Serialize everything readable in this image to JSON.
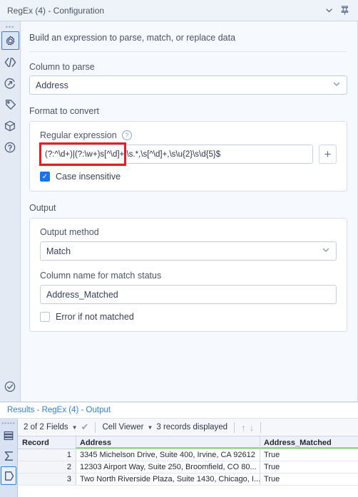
{
  "window": {
    "title": "RegEx (4) - Configuration",
    "collapse_icon": "chevron-down-icon",
    "pin_icon": "pin-icon"
  },
  "rail": {
    "items": [
      {
        "icon": "gear-icon",
        "name": "configuration",
        "selected": true
      },
      {
        "icon": "code-brackets-icon",
        "name": "code",
        "selected": false
      },
      {
        "icon": "annotation-arrow-icon",
        "name": "annotation",
        "selected": false
      },
      {
        "icon": "tag-icon",
        "name": "tag",
        "selected": false
      },
      {
        "icon": "package-cube-icon",
        "name": "package",
        "selected": false
      },
      {
        "icon": "question-circle-icon",
        "name": "help",
        "selected": false
      }
    ],
    "bottom": {
      "icon": "check-circle-icon",
      "name": "validate"
    }
  },
  "form": {
    "intro": "Build an expression to parse, match, or replace data",
    "column_to_parse": {
      "label": "Column to parse",
      "value": "Address"
    },
    "format_section": {
      "label": "Format to convert",
      "regex": {
        "label": "Regular expression",
        "help_icon": "question-circle-icon",
        "value": "(?:^\\d+)|(?:\\w+)s[^\\d]+,\\s.*,\\s[^\\d]+,\\s\\u{2}\\s\\d{5}$",
        "highlight_color": "#e31f26",
        "add_button_label": "+"
      },
      "case_insensitive": {
        "label": "Case insensitive",
        "checked": true
      }
    },
    "output_section": {
      "label": "Output",
      "output_method": {
        "label": "Output method",
        "value": "Match"
      },
      "match_status_column": {
        "label": "Column name for match status",
        "value": "Address_Matched"
      },
      "error_if_not_matched": {
        "label": "Error if not matched",
        "checked": false
      }
    }
  },
  "results": {
    "title": "Results - RegEx (4) - Output",
    "rail": [
      {
        "icon": "table-rows-icon",
        "name": "data-view",
        "selected": false
      },
      {
        "icon": "sigma-icon",
        "name": "profile-view",
        "selected": false
      },
      {
        "icon": "hexagon-icon",
        "name": "metadata-view",
        "selected": true
      }
    ],
    "toolbar": {
      "fields": "2 of 2 Fields",
      "fields_caret": "caret-down-icon",
      "check_icon": "checkmark-icon",
      "cell_viewer": "Cell Viewer",
      "cell_viewer_caret": "caret-down-icon",
      "records": "3 records displayed",
      "up_icon": "arrow-up-icon",
      "down_icon": "arrow-down-icon"
    },
    "table": {
      "columns": [
        "Record",
        "Address",
        "Address_Matched"
      ],
      "rows": [
        {
          "record": "1",
          "address": "3345 Michelson Drive, Suite 400, Irvine, CA 92612",
          "matched": "True"
        },
        {
          "record": "2",
          "address": "12303 Airport Way, Suite 250, Broomfield, CO 80...",
          "matched": "True"
        },
        {
          "record": "3",
          "address": "Two North Riverside Plaza, Suite 1430, Chicago, I...",
          "matched": "True"
        }
      ]
    }
  },
  "colors": {
    "accent_blue": "#2f7fe0",
    "highlight_red": "#e31f26",
    "checkbox_blue": "#1b73e8",
    "header_green": "#8fdb6b",
    "panel_bg": "#f6f9fd",
    "rail_bg": "#e4eaf4"
  }
}
